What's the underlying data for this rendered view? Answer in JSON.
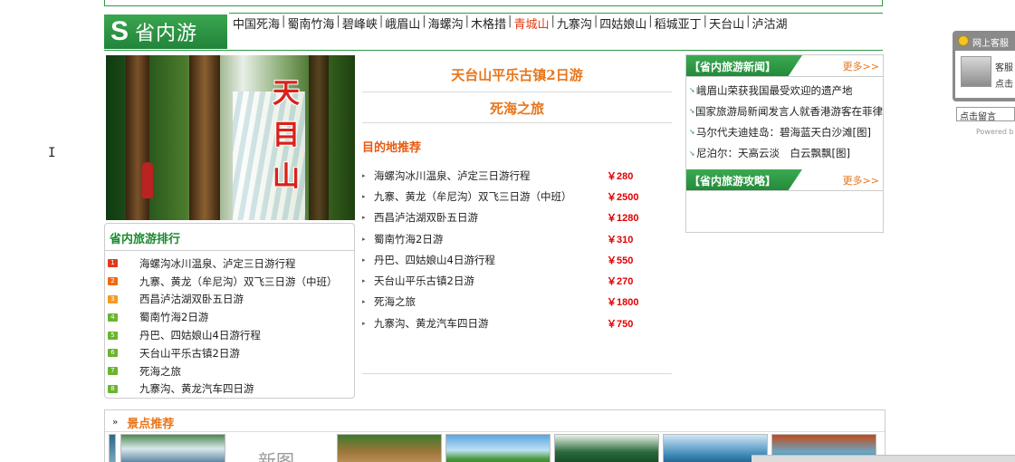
{
  "header": {
    "logo_letter": "S",
    "logo_text": "省内游",
    "nav": [
      "中国死海",
      "蜀南竹海",
      "碧峰峡",
      "峨眉山",
      "海螺沟",
      "木格措",
      "青城山",
      "九寨沟",
      "四姑娘山",
      "稻城亚丁",
      "天台山",
      "泸沽湖"
    ],
    "nav_active": "青城山"
  },
  "hero": {
    "vertical_title": [
      "天",
      "目",
      "山"
    ]
  },
  "ranking": {
    "title": "省内旅游排行",
    "items": [
      {
        "num": "1",
        "label": "海螺沟冰川温泉、泸定三日游行程",
        "color": "#e03a1a"
      },
      {
        "num": "2",
        "label": "九寨、黄龙（牟尼沟）双飞三日游（中班）",
        "color": "#ef6a14"
      },
      {
        "num": "3",
        "label": "西昌泸沽湖双卧五日游",
        "color": "#f39a1e"
      },
      {
        "num": "4",
        "label": "蜀南竹海2日游",
        "color": "#6ab42e"
      },
      {
        "num": "5",
        "label": "丹巴、四姑娘山4日游行程",
        "color": "#6ab42e"
      },
      {
        "num": "6",
        "label": "天台山平乐古镇2日游",
        "color": "#6ab42e"
      },
      {
        "num": "7",
        "label": "死海之旅",
        "color": "#6ab42e"
      },
      {
        "num": "8",
        "label": "九寨沟、黄龙汽车四日游",
        "color": "#6ab42e"
      }
    ]
  },
  "featured": {
    "title1": "天台山平乐古镇2日游",
    "title2": "死海之旅",
    "dest_title": "目的地推荐",
    "items": [
      {
        "label": "海螺沟冰川温泉、泸定三日游行程",
        "price": "￥280"
      },
      {
        "label": "九寨、黄龙（牟尼沟）双飞三日游（中班）",
        "price": "￥2500"
      },
      {
        "label": "西昌泸沽湖双卧五日游",
        "price": "￥1280"
      },
      {
        "label": "蜀南竹海2日游",
        "price": "￥310"
      },
      {
        "label": "丹巴、四姑娘山4日游行程",
        "price": "￥550"
      },
      {
        "label": "天台山平乐古镇2日游",
        "price": "￥270"
      },
      {
        "label": "死海之旅",
        "price": "￥1800"
      },
      {
        "label": "九寨沟、黄龙汽车四日游",
        "price": "￥750"
      }
    ]
  },
  "news": {
    "title": "【省内旅游新闻】",
    "more": "更多>>",
    "items": [
      "峨眉山荣获我国最受欢迎的遗产地",
      "国家旅游局新闻发言人就香港游客在菲律",
      "马尔代夫迪娃岛：碧海蓝天白沙滩[图]",
      "尼泊尔：天高云淡　白云飘飘[图]"
    ]
  },
  "guide": {
    "title": "【省内旅游攻略】",
    "more": "更多>>"
  },
  "service": {
    "title": "网上客服",
    "line1": "客服",
    "line2": "点击",
    "leave_message": "点击留言 _",
    "powered": "Powered b"
  },
  "scenic": {
    "title": "景点推荐",
    "marker": "»",
    "placeholder_text": "新图"
  },
  "colors": {
    "brand_green": "#2e9a47",
    "accent_orange": "#e8751a",
    "price_red": "#e20000",
    "nav_active": "#e23a14"
  }
}
